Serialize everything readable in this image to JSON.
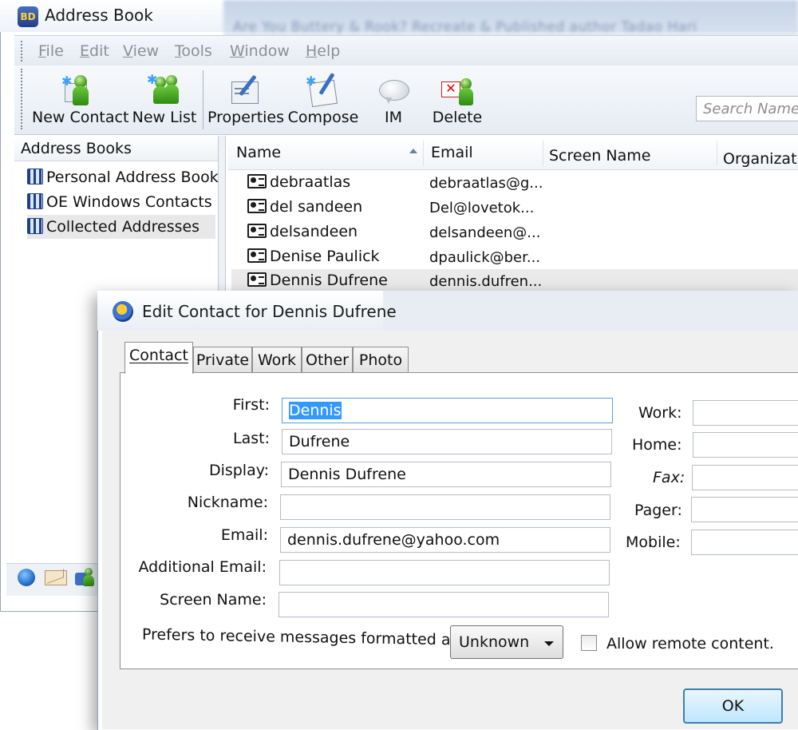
{
  "window": {
    "title": "Address Book",
    "app_icon": "address-book-icon"
  },
  "blurred_title_text": "Are You Buttery & Rook? Recreate & Published author Tadao Hari",
  "menu": [
    {
      "label": "File",
      "ul": "F"
    },
    {
      "label": "Edit",
      "ul": "E"
    },
    {
      "label": "View",
      "ul": "V"
    },
    {
      "label": "Tools",
      "ul": "T"
    },
    {
      "label": "Window",
      "ul": "W"
    },
    {
      "label": "Help",
      "ul": "H"
    }
  ],
  "toolbar": {
    "new_contact": "New Contact",
    "new_list": "New List",
    "properties": "Properties",
    "compose": "Compose",
    "im": "IM",
    "delete": "Delete"
  },
  "search": {
    "placeholder": "Search Name"
  },
  "left_pane": {
    "header": "Address Books",
    "books": [
      {
        "label": "Personal Address Book"
      },
      {
        "label": "OE Windows Contacts"
      },
      {
        "label": "Collected Addresses"
      }
    ]
  },
  "list": {
    "columns": [
      "Name",
      "Email",
      "Screen Name",
      "Organizati"
    ],
    "rows": [
      {
        "name": "debraatlas",
        "email": "debraatlas@g..."
      },
      {
        "name": "del sandeen",
        "email": "Del@lovetok..."
      },
      {
        "name": "delsandeen",
        "email": "delsandeen@..."
      },
      {
        "name": "Denise Paulick",
        "email": "dpaulick@ber..."
      },
      {
        "name": "Dennis Dufrene",
        "email": "dennis.dufren..."
      }
    ]
  },
  "dialog": {
    "title": "Edit Contact for Dennis Dufrene",
    "tabs": [
      "Contact",
      "Private",
      "Work",
      "Other",
      "Photo"
    ],
    "fields": {
      "first_label": "First:",
      "first_value": "Dennis",
      "last_label": "Last:",
      "last_value": "Dufrene",
      "display_label": "Display:",
      "display_value": "Dennis Dufrene",
      "nickname_label": "Nickname:",
      "nickname_value": "",
      "email_label": "Email:",
      "email_value": "dennis.dufrene@yahoo.com",
      "additional_email_label": "Additional Email:",
      "additional_email_value": "",
      "screen_name_label": "Screen Name:",
      "screen_name_value": ""
    },
    "phones": {
      "work_label": "Work:",
      "home_label": "Home:",
      "fax_label": "Fax:",
      "pager_label": "Pager:",
      "mobile_label": "Mobile:"
    },
    "format_label": "Prefers to receive messages formatted as:",
    "format_value": "Unknown",
    "allow_remote_label": "Allow remote content.",
    "allow_remote_checked": false,
    "ok_label": "OK"
  },
  "colors": {
    "selection": "#3399ff",
    "row_selected": "#eaeaea",
    "ok_border": "#3c7fb1"
  }
}
